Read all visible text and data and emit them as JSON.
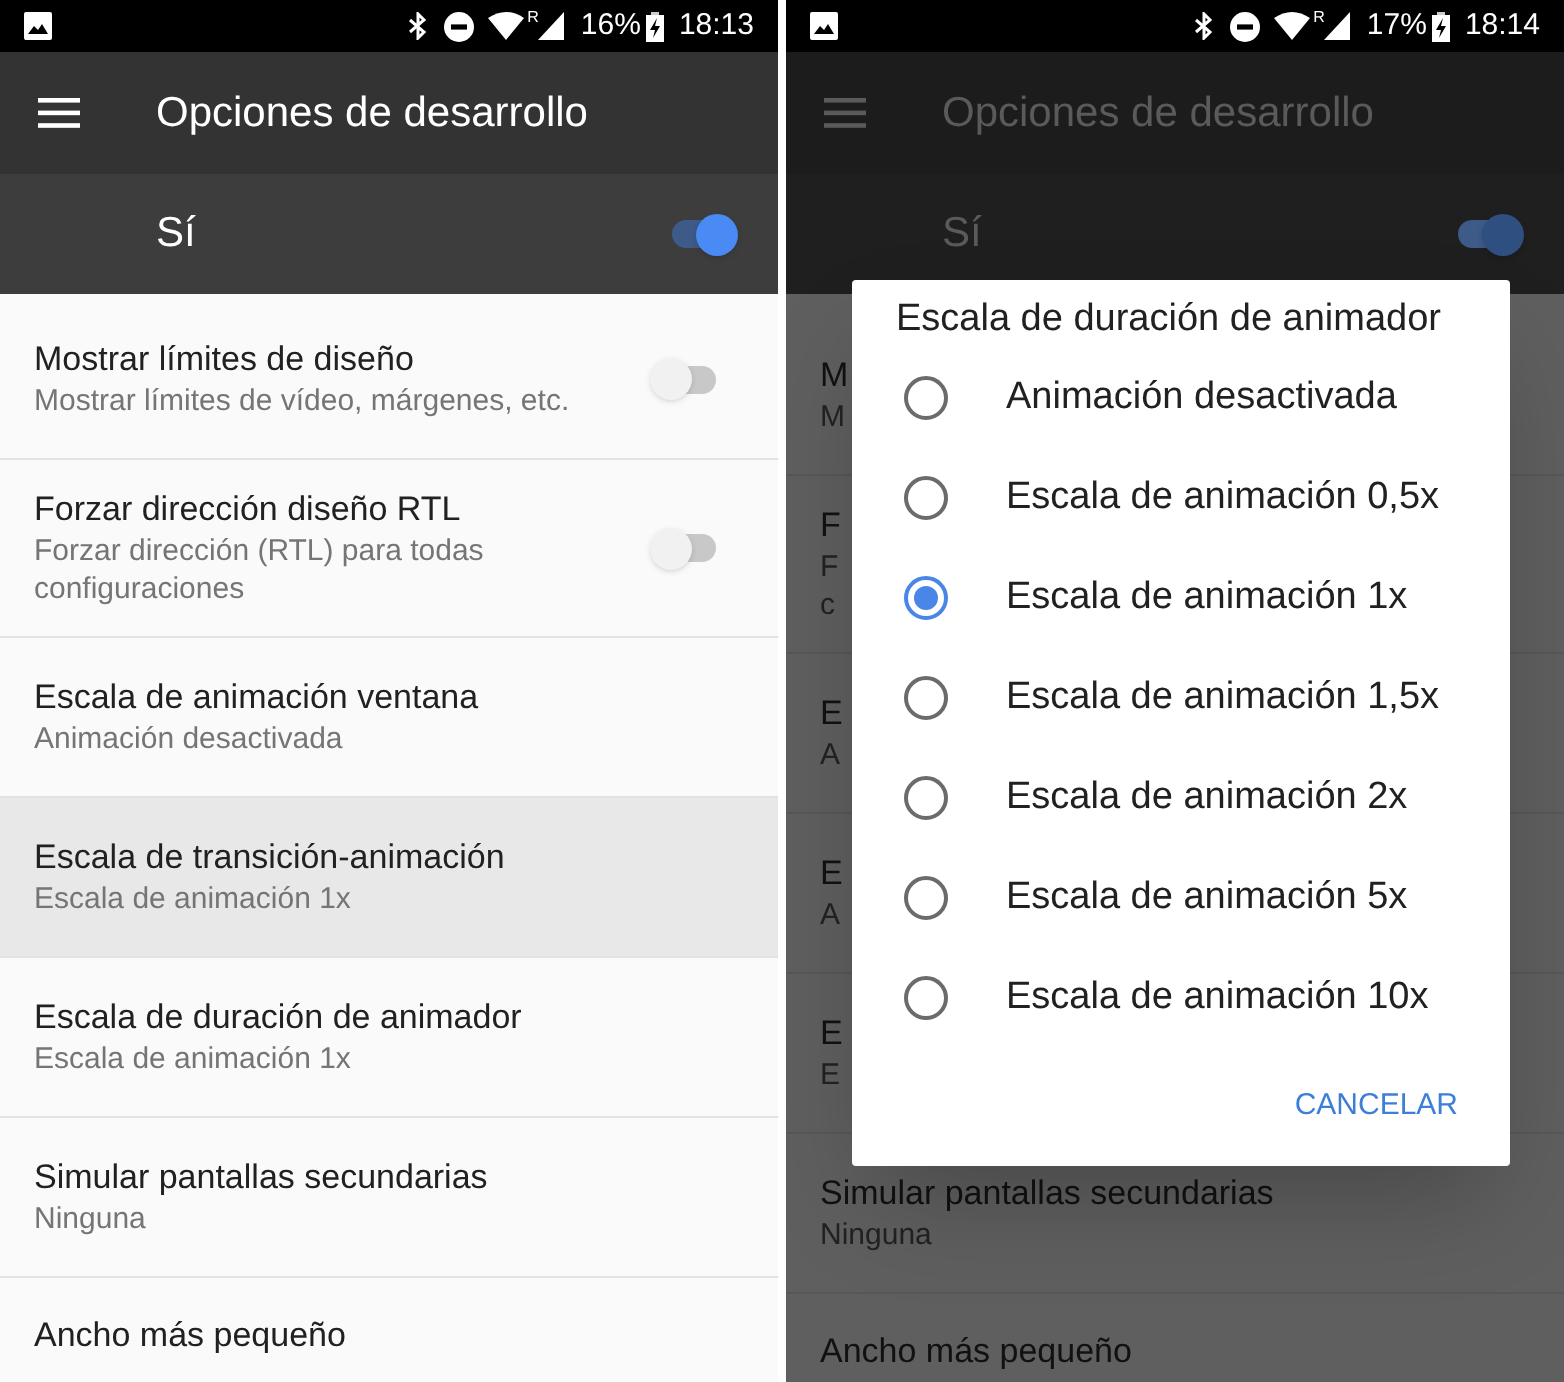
{
  "screens": [
    {
      "status_bar": {
        "roaming": "R",
        "battery": "16%",
        "time": "18:13"
      },
      "toolbar": {
        "title": "Opciones de desarrollo"
      },
      "master_switch": {
        "label": "Sí",
        "on": true
      },
      "settings": [
        {
          "kind": "toggle",
          "title": "Mostrar límites de diseño",
          "summary": [
            "Mostrar límites de vídeo, márgenes, etc."
          ],
          "on": false,
          "highlighted": false
        },
        {
          "kind": "toggle",
          "title": "Forzar dirección diseño RTL",
          "summary": [
            "Forzar dirección (RTL) para todas",
            "configuraciones"
          ],
          "on": false,
          "highlighted": false
        },
        {
          "kind": "text",
          "title": "Escala de animación ventana",
          "summary": [
            "Animación desactivada"
          ],
          "highlighted": false
        },
        {
          "kind": "text",
          "title": "Escala de transición-animación",
          "summary": [
            "Escala de animación 1x"
          ],
          "highlighted": true
        },
        {
          "kind": "text",
          "title": "Escala de duración de animador",
          "summary": [
            "Escala de animación 1x"
          ],
          "highlighted": false
        },
        {
          "kind": "text",
          "title": "Simular pantallas secundarias",
          "summary": [
            "Ninguna"
          ],
          "highlighted": false
        },
        {
          "kind": "text",
          "title": "Ancho más pequeño",
          "highlighted": false
        }
      ]
    },
    {
      "status_bar": {
        "roaming": "R",
        "battery": "17%",
        "time": "18:14"
      },
      "toolbar": {
        "title": "Opciones de desarrollo"
      },
      "master_switch": {
        "label": "Sí",
        "on": true
      },
      "settings": [
        {
          "kind": "text",
          "title": "M",
          "summary": [
            "M"
          ],
          "highlighted": false
        },
        {
          "kind": "text",
          "title": "F",
          "summary": [
            "F",
            "c"
          ],
          "highlighted": false
        },
        {
          "kind": "text",
          "title": "E",
          "summary": [
            "A"
          ],
          "highlighted": false
        },
        {
          "kind": "text",
          "title": "E",
          "summary": [
            "A"
          ],
          "highlighted": false
        },
        {
          "kind": "text",
          "title": "E",
          "summary": [
            "E"
          ],
          "highlighted": false
        },
        {
          "kind": "text",
          "title": "Simular pantallas secundarias",
          "summary": [
            "Ninguna"
          ],
          "highlighted": false
        },
        {
          "kind": "text",
          "title": "Ancho más pequeño",
          "highlighted": false
        }
      ],
      "dialog": {
        "title": "Escala de duración de animador",
        "options": [
          {
            "label": "Animación desactivada",
            "selected": false
          },
          {
            "label": "Escala de animación 0,5x",
            "selected": false
          },
          {
            "label": "Escala de animación 1x",
            "selected": true
          },
          {
            "label": "Escala de animación 1,5x",
            "selected": false
          },
          {
            "label": "Escala de animación 2x",
            "selected": false
          },
          {
            "label": "Escala de animación 5x",
            "selected": false
          },
          {
            "label": "Escala de animación 10x",
            "selected": false
          }
        ],
        "button": "CANCELAR"
      }
    }
  ]
}
